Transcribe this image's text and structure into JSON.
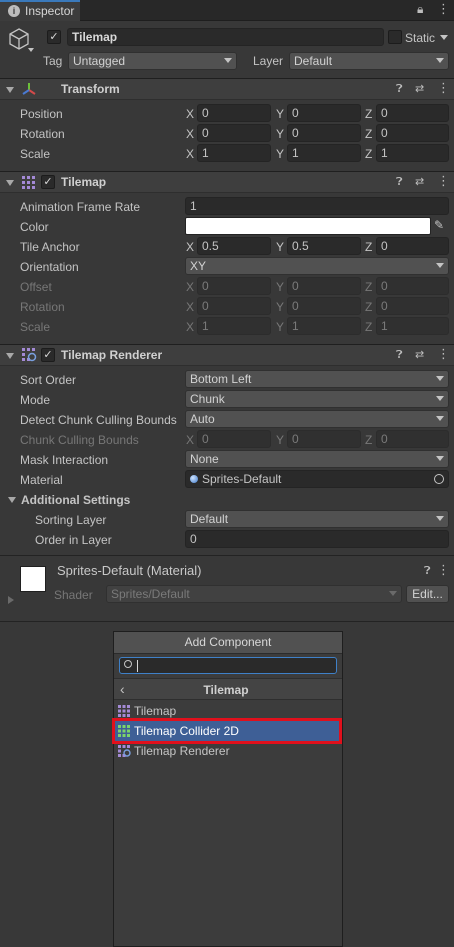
{
  "tab": {
    "label": "Inspector"
  },
  "object": {
    "name": "Tilemap",
    "static_label": "Static",
    "tag_label": "Tag",
    "tag_value": "Untagged",
    "layer_label": "Layer",
    "layer_value": "Default"
  },
  "transform": {
    "title": "Transform",
    "rows": [
      {
        "label": "Position",
        "x": "0",
        "y": "0",
        "z": "0"
      },
      {
        "label": "Rotation",
        "x": "0",
        "y": "0",
        "z": "0"
      },
      {
        "label": "Scale",
        "x": "1",
        "y": "1",
        "z": "1"
      }
    ]
  },
  "tilemap": {
    "title": "Tilemap",
    "frame_rate_label": "Animation Frame Rate",
    "frame_rate_value": "1",
    "color_label": "Color",
    "color_value": "#ffffff",
    "anchor_label": "Tile Anchor",
    "anchor_x": "0.5",
    "anchor_y": "0.5",
    "anchor_z": "0",
    "orientation_label": "Orientation",
    "orientation_value": "XY",
    "offset_label": "Offset",
    "offset_x": "0",
    "offset_y": "0",
    "offset_z": "0",
    "rotation_label": "Rotation",
    "rotation_x": "0",
    "rotation_y": "0",
    "rotation_z": "0",
    "scale_label": "Scale",
    "scale_x": "1",
    "scale_y": "1",
    "scale_z": "1"
  },
  "renderer": {
    "title": "Tilemap Renderer",
    "sort_order_label": "Sort Order",
    "sort_order_value": "Bottom Left",
    "mode_label": "Mode",
    "mode_value": "Chunk",
    "culling_label": "Detect Chunk Culling Bounds",
    "culling_value": "Auto",
    "chunk_bounds_label": "Chunk Culling Bounds",
    "chunk_x": "0",
    "chunk_y": "0",
    "chunk_z": "0",
    "mask_label": "Mask Interaction",
    "mask_value": "None",
    "material_label": "Material",
    "material_value": "Sprites-Default",
    "additional_label": "Additional Settings",
    "sorting_layer_label": "Sorting Layer",
    "sorting_layer_value": "Default",
    "order_label": "Order in Layer",
    "order_value": "0"
  },
  "material": {
    "name": "Sprites-Default (Material)",
    "shader_label": "Shader",
    "shader_value": "Sprites/Default",
    "edit_label": "Edit..."
  },
  "add_component": {
    "button_label": "Add Component",
    "search_value": "",
    "category": "Tilemap",
    "items": [
      {
        "label": "Tilemap"
      },
      {
        "label": "Tilemap Collider 2D"
      },
      {
        "label": "Tilemap Renderer"
      }
    ]
  },
  "axes": {
    "x": "X",
    "y": "Y",
    "z": "Z"
  },
  "colors": {
    "selection": "#3e5f96",
    "highlight_border": "#e0101c"
  }
}
